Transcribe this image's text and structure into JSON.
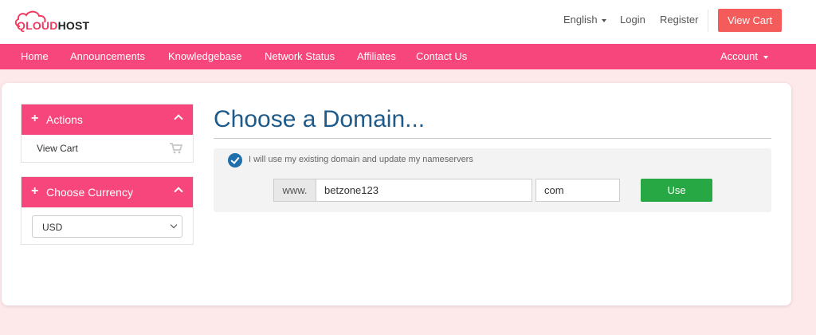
{
  "brand": {
    "logo_q": "QLOUD",
    "logo_h": "HOST",
    "accent": "#f7467b",
    "cta_color": "#f45b5b"
  },
  "header": {
    "language": "English",
    "login": "Login",
    "register": "Register",
    "view_cart": "View Cart"
  },
  "nav": {
    "items": [
      {
        "label": "Home"
      },
      {
        "label": "Announcements"
      },
      {
        "label": "Knowledgebase"
      },
      {
        "label": "Network Status"
      },
      {
        "label": "Affiliates"
      },
      {
        "label": "Contact Us"
      }
    ],
    "account": "Account"
  },
  "sidebar": {
    "actions": {
      "title": "Actions",
      "items": [
        {
          "label": "View Cart",
          "icon": "cart-icon"
        }
      ]
    },
    "currency": {
      "title": "Choose Currency",
      "selected": "USD"
    }
  },
  "main": {
    "title": "Choose a Domain...",
    "option_label": "I will use my existing domain and update my nameservers",
    "www_prefix": "www.",
    "sld_value": "betzone123",
    "tld_value": "com",
    "use_button": "Use",
    "use_color": "#28a745"
  }
}
